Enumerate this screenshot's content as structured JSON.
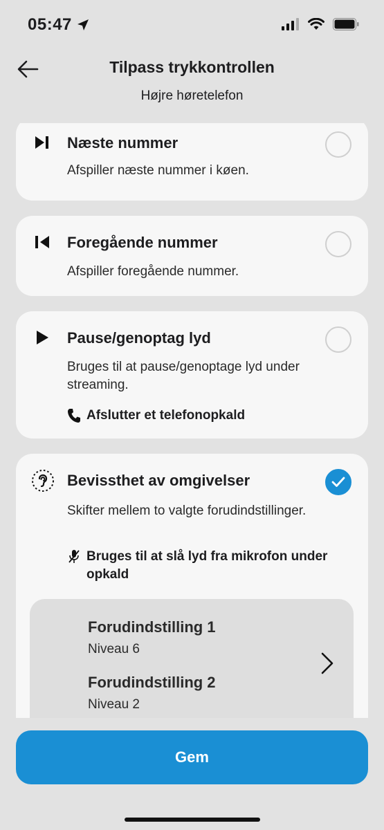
{
  "status": {
    "time": "05:47",
    "icons": [
      "location-arrow-icon",
      "cellular-signal-icon",
      "wifi-icon",
      "battery-icon"
    ]
  },
  "header": {
    "back_icon": "arrow-left-icon",
    "title": "Tilpass trykkontrollen",
    "subtitle": "Højre høretelefon"
  },
  "options": [
    {
      "icon": "next-track-icon",
      "title": "Næste nummer",
      "description": "Afspiller næste nummer i køen.",
      "selected": false
    },
    {
      "icon": "previous-track-icon",
      "title": "Foregående nummer",
      "description": "Afspiller foregående nummer.",
      "selected": false
    },
    {
      "icon": "play-icon",
      "title": "Pause/genoptag lyd",
      "description": "Bruges til at pause/genoptage lyd under streaming.",
      "note_icon": "phone-icon",
      "note": "Afslutter et telefonopkald",
      "selected": false
    },
    {
      "icon": "ambient-awareness-icon",
      "title": "Bevissthet av omgivelser",
      "description": "Skifter mellem to valgte forudindstillinger.",
      "note_icon": "mic-off-icon",
      "note": "Bruges til at slå lyd fra mikrofon under opkald",
      "selected": true,
      "presets": [
        {
          "name": "Forudindstilling 1",
          "level": "Niveau 6"
        },
        {
          "name": "Forudindstilling 2",
          "level": "Niveau 2"
        }
      ]
    }
  ],
  "footer": {
    "save_label": "Gem"
  },
  "colors": {
    "accent": "#1a8fd4",
    "background": "#e2e2e2",
    "card": "#f7f7f7",
    "preset_panel": "#dedede"
  }
}
